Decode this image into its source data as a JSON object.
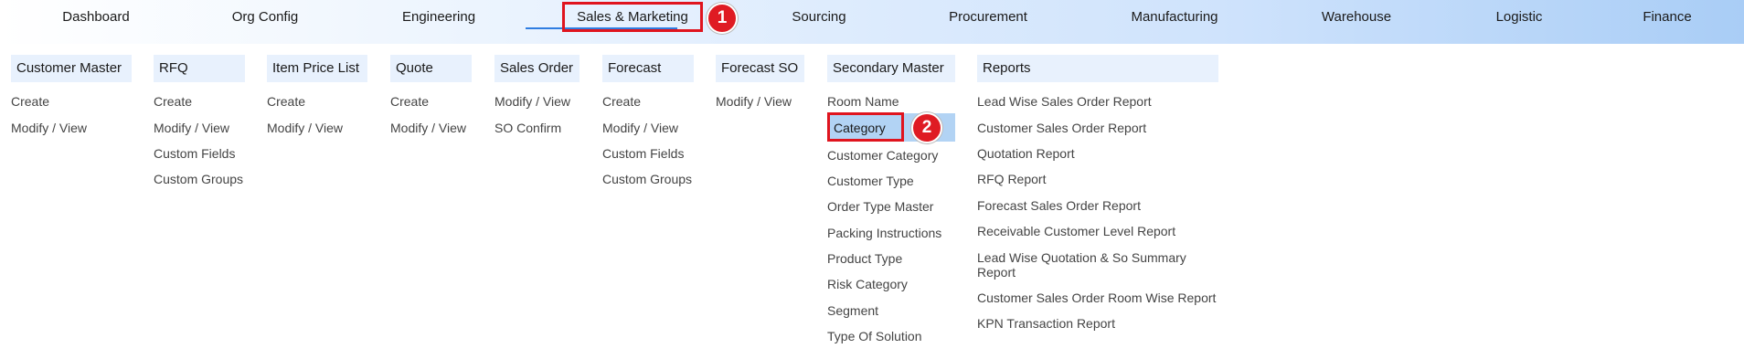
{
  "topnav": {
    "items": [
      "Dashboard",
      "Org Config",
      "Engineering",
      "Sales & Marketing",
      "Sourcing",
      "Procurement",
      "Manufacturing",
      "Warehouse",
      "Logistic",
      "Finance"
    ],
    "active": "Sales & Marketing"
  },
  "annotations": {
    "badge1": "1",
    "badge2": "2"
  },
  "colors": {
    "highlight": "#e0141e",
    "active_underline": "#2f7de1",
    "header_bg": "#e8f1fd",
    "selected_bg": "#b2d3f4"
  },
  "menu": {
    "customer_master": {
      "header": "Customer Master",
      "items": [
        "Create",
        "Modify / View"
      ]
    },
    "rfq": {
      "header": "RFQ",
      "items": [
        "Create",
        "Modify / View",
        "Custom Fields",
        "Custom Groups"
      ]
    },
    "item_price_list": {
      "header": "Item Price List",
      "items": [
        "Create",
        "Modify / View"
      ]
    },
    "quote": {
      "header": "Quote",
      "items": [
        "Create",
        "Modify / View"
      ]
    },
    "sales_order": {
      "header": "Sales Order",
      "items": [
        "Modify / View",
        "SO Confirm"
      ]
    },
    "forecast": {
      "header": "Forecast",
      "items": [
        "Create",
        "Modify / View",
        "Custom Fields",
        "Custom Groups"
      ]
    },
    "forecast_so": {
      "header": "Forecast SO",
      "items": [
        "Modify / View"
      ]
    },
    "secondary_master": {
      "header": "Secondary Master",
      "items": [
        "Room Name",
        "Category",
        "Customer Category",
        "Customer Type",
        "Order Type Master",
        "Packing Instructions",
        "Product Type",
        "Risk Category",
        "Segment",
        "Type Of Solution"
      ],
      "selected": "Category"
    },
    "reports": {
      "header": "Reports",
      "items": [
        "Lead Wise Sales Order Report",
        "Customer Sales Order Report",
        "Quotation Report",
        "RFQ Report",
        "Forecast Sales Order Report",
        "Receivable Customer Level Report",
        "Lead Wise Quotation & So Summary Report",
        "Customer Sales Order Room Wise Report",
        "KPN Transaction Report"
      ]
    }
  }
}
